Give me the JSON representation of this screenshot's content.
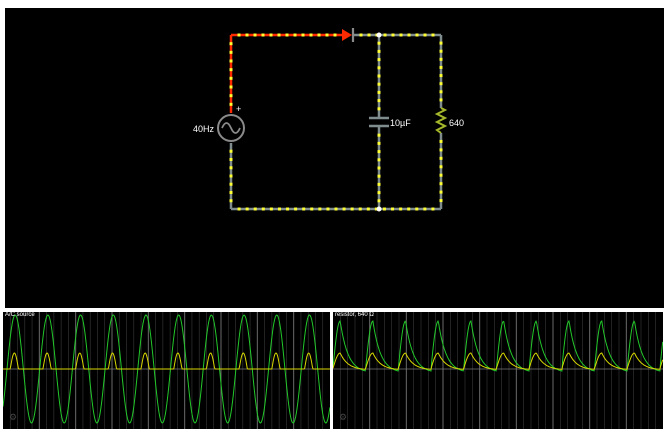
{
  "colors": {
    "background": "#000000",
    "wire_idle": "#7f8c8d",
    "wire_hot": "#ff2a00",
    "current_dot": "#ffff33",
    "scope_voltage": "#22c82a",
    "scope_current": "#d8d800",
    "scope_grid": "#3a3a3a"
  },
  "circuit": {
    "source": {
      "label": "40Hz",
      "icon": "ac-source-icon",
      "plus_mark": "+"
    },
    "diode": {
      "icon": "diode-icon"
    },
    "capacitor": {
      "label": "10µF",
      "icon": "capacitor-icon"
    },
    "resistor": {
      "label": "640",
      "icon": "resistor-icon"
    }
  },
  "scopes": [
    {
      "title": "A/C source",
      "settings_icon": "gear-icon"
    },
    {
      "title": "resistor, 640 Ω",
      "settings_icon": "gear-icon"
    }
  ]
}
